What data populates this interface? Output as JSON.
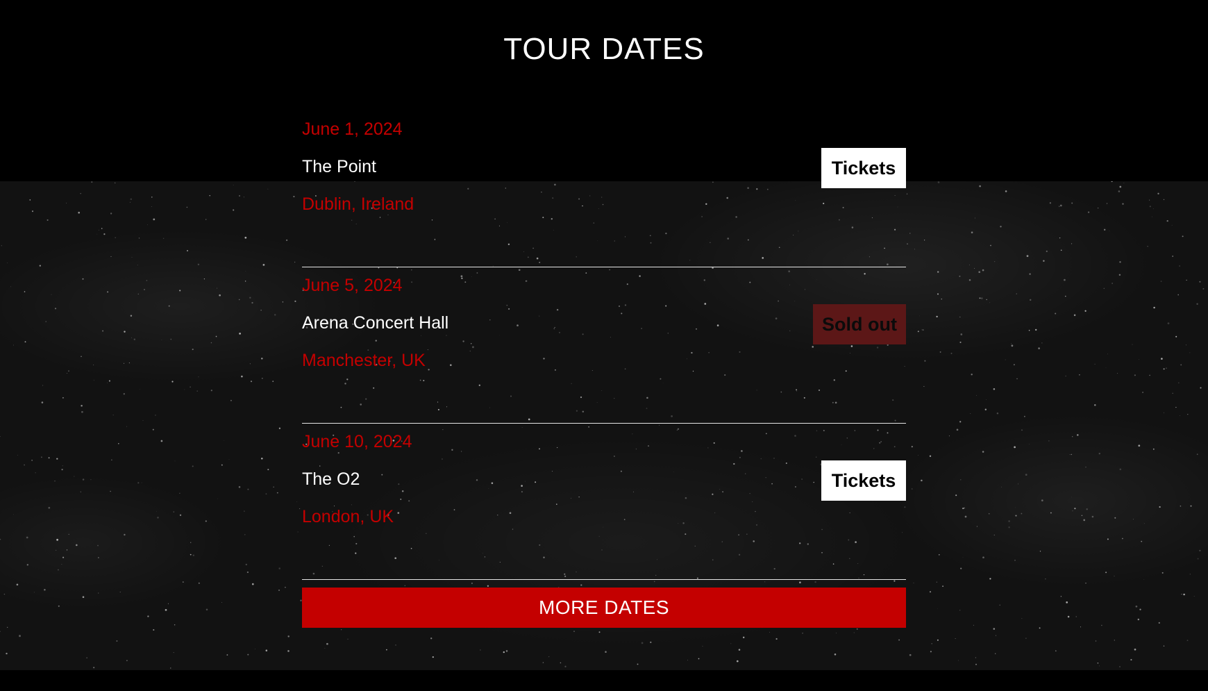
{
  "section": {
    "title": "TOUR DATES"
  },
  "events": [
    {
      "date": "June 1, 2024",
      "venue": "The Point",
      "location": "Dublin, Ireland",
      "action": "Tickets",
      "status": "available"
    },
    {
      "date": "June 5, 2024",
      "venue": "Arena Concert Hall",
      "location": "Manchester, UK",
      "action": "Sold out",
      "status": "sold-out"
    },
    {
      "date": "June 10, 2024",
      "venue": "The O2",
      "location": "London, UK",
      "action": "Tickets",
      "status": "available"
    }
  ],
  "more_button": {
    "label": "MORE DATES"
  },
  "colors": {
    "accent": "#c40000",
    "sold_out_bg": "#5c1717",
    "background": "#000000",
    "texture": "#121212"
  }
}
